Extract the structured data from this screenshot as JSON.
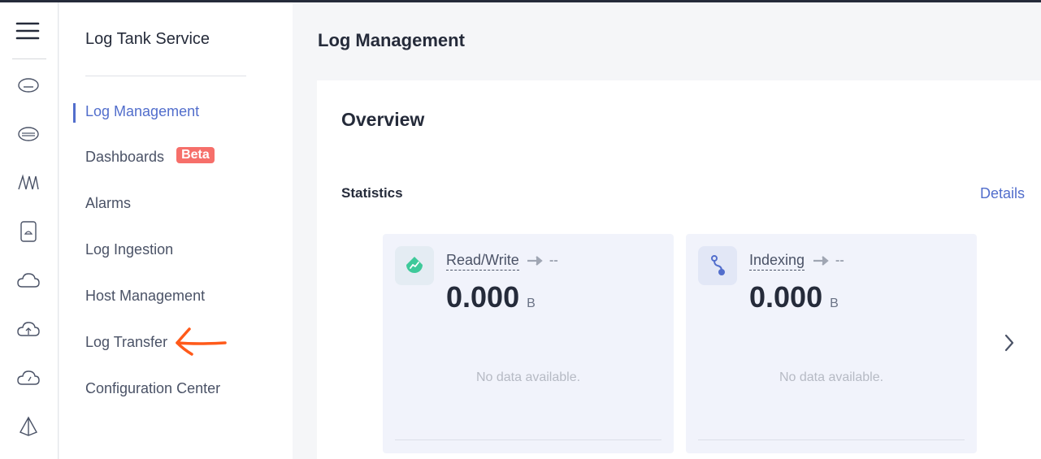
{
  "sidebar": {
    "title": "Log Tank Service",
    "items": [
      {
        "label": "Log Management",
        "active": true
      },
      {
        "label": "Dashboards",
        "badge": "Beta"
      },
      {
        "label": "Alarms"
      },
      {
        "label": "Log Ingestion"
      },
      {
        "label": "Host Management"
      },
      {
        "label": "Log Transfer"
      },
      {
        "label": "Configuration Center"
      }
    ]
  },
  "rail_icons": [
    "menu-icon",
    "storage-icon",
    "database-icon",
    "waveform-icon",
    "device-icon",
    "cloud-icon",
    "cloud-upload-icon",
    "cloud-gauge-icon",
    "pyramid-icon"
  ],
  "header": {
    "title": "Log Management"
  },
  "overview": {
    "title": "Overview",
    "statistics_label": "Statistics",
    "details_link": "Details",
    "cards": [
      {
        "name": "Read/Write",
        "trend": "--",
        "value": "0.000",
        "unit": "B",
        "empty_text": "No data available."
      },
      {
        "name": "Indexing",
        "trend": "--",
        "value": "0.000",
        "unit": "B",
        "empty_text": "No data available."
      }
    ]
  },
  "colors": {
    "accent": "#526ecc",
    "beta_badge": "#f66f6a",
    "arrow_annotation": "#ff5a1a",
    "read_write_icon": "#3ec99a",
    "indexing_icon": "#526ecc"
  }
}
